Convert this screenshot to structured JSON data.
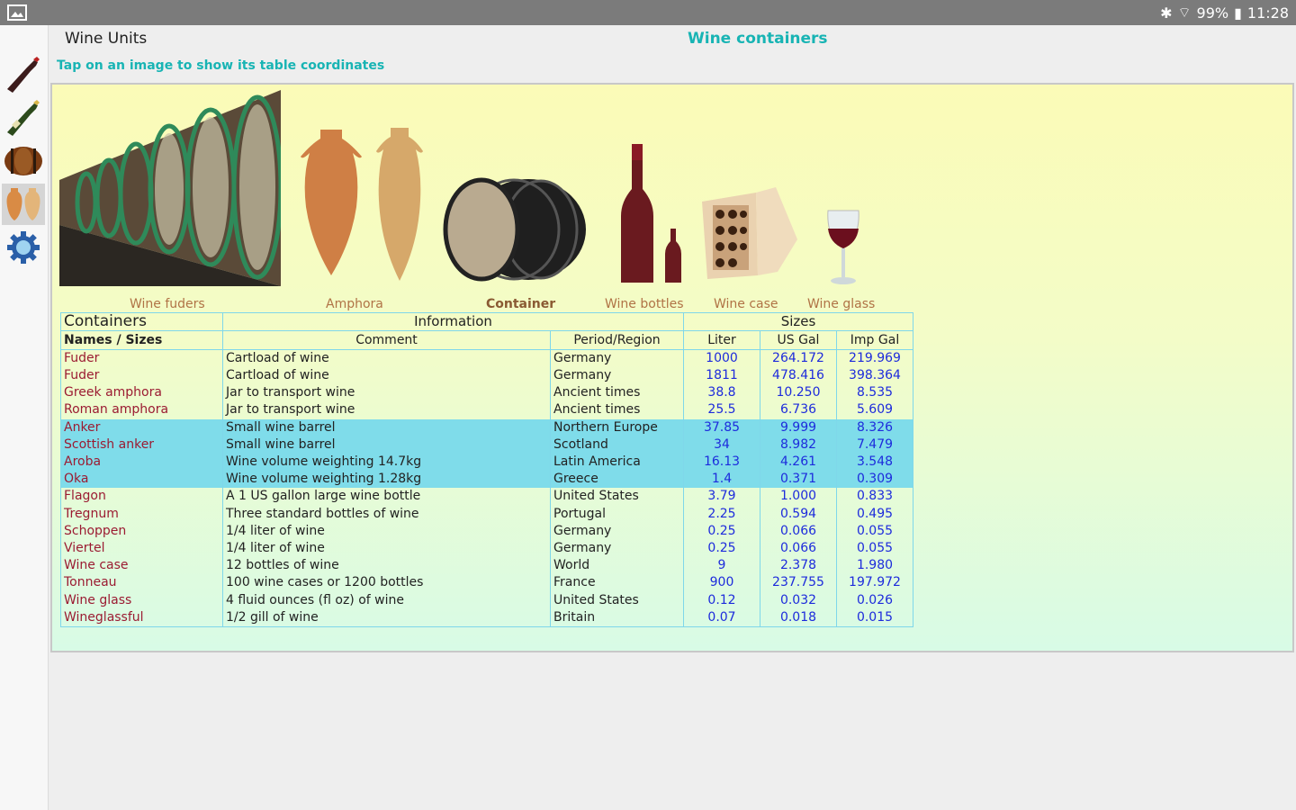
{
  "status": {
    "battery": "99%",
    "time": "11:28"
  },
  "header": {
    "app_title": "Wine Units",
    "page_title": "Wine containers",
    "hint": "Tap on an image to show its table coordinates"
  },
  "sidebar": {
    "items": [
      {
        "icon": "red-wine-bottle-icon"
      },
      {
        "icon": "white-wine-bottle-icon"
      },
      {
        "icon": "barrel-icon"
      },
      {
        "icon": "amphora-icon",
        "active": true
      },
      {
        "icon": "gear-icon"
      }
    ]
  },
  "images": {
    "fuders": "Wine fuders",
    "amphora": "Amphora",
    "container": "Container",
    "bottles": "Wine bottles",
    "case": "Wine case",
    "glass": "Wine glass"
  },
  "table": {
    "group_headers": {
      "containers": "Containers",
      "information": "Information",
      "sizes": "Sizes"
    },
    "columns": {
      "names": "Names / Sizes",
      "comment": "Comment",
      "region": "Period/Region",
      "liter": "Liter",
      "usgal": "US Gal",
      "impgal": "Imp Gal"
    },
    "rows": [
      {
        "name": "Fuder",
        "comment": "Cartload of wine",
        "region": "Germany",
        "liter": "1000",
        "usgal": "264.172",
        "impgal": "219.969"
      },
      {
        "name": "Fuder",
        "comment": "Cartload of wine",
        "region": "Germany",
        "liter": "1811",
        "usgal": "478.416",
        "impgal": "398.364"
      },
      {
        "name": "Greek amphora",
        "comment": "Jar to transport wine",
        "region": "Ancient times",
        "liter": "38.8",
        "usgal": "10.250",
        "impgal": "8.535"
      },
      {
        "name": "Roman amphora",
        "comment": "Jar to transport wine",
        "region": "Ancient times",
        "liter": "25.5",
        "usgal": "6.736",
        "impgal": "5.609"
      },
      {
        "name": "Anker",
        "comment": "Small wine barrel",
        "region": "Northern Europe",
        "liter": "37.85",
        "usgal": "9.999",
        "impgal": "8.326"
      },
      {
        "name": "Scottish anker",
        "comment": "Small wine barrel",
        "region": "Scotland",
        "liter": "34",
        "usgal": "8.982",
        "impgal": "7.479"
      },
      {
        "name": "Aroba",
        "comment": "Wine volume weighting 14.7kg",
        "region": "Latin America",
        "liter": "16.13",
        "usgal": "4.261",
        "impgal": "3.548"
      },
      {
        "name": "Oka",
        "comment": "Wine volume weighting 1.28kg",
        "region": "Greece",
        "liter": "1.4",
        "usgal": "0.371",
        "impgal": "0.309"
      },
      {
        "name": "Flagon",
        "comment": "A 1 US gallon large wine bottle",
        "region": "United States",
        "liter": "3.79",
        "usgal": "1.000",
        "impgal": "0.833"
      },
      {
        "name": "Tregnum",
        "comment": "Three standard bottles of wine",
        "region": "Portugal",
        "liter": "2.25",
        "usgal": "0.594",
        "impgal": "0.495"
      },
      {
        "name": "Schoppen",
        "comment": "1/4 liter of wine",
        "region": "Germany",
        "liter": "0.25",
        "usgal": "0.066",
        "impgal": "0.055"
      },
      {
        "name": "Viertel",
        "comment": "1/4 liter of wine",
        "region": "Germany",
        "liter": "0.25",
        "usgal": "0.066",
        "impgal": "0.055"
      },
      {
        "name": "Wine case",
        "comment": "12 bottles of wine",
        "region": "World",
        "liter": "9",
        "usgal": "2.378",
        "impgal": "1.980"
      },
      {
        "name": "Tonneau",
        "comment": "100 wine cases or 1200 bottles",
        "region": "France",
        "liter": "900",
        "usgal": "237.755",
        "impgal": "197.972"
      },
      {
        "name": "Wine glass",
        "comment": "4 fluid ounces (fl oz) of wine",
        "region": "United States",
        "liter": "0.12",
        "usgal": "0.032",
        "impgal": "0.026"
      },
      {
        "name": "Wineglassful",
        "comment": "1/2 gill of wine",
        "region": "Britain",
        "liter": "0.07",
        "usgal": "0.018",
        "impgal": "0.015"
      }
    ]
  }
}
